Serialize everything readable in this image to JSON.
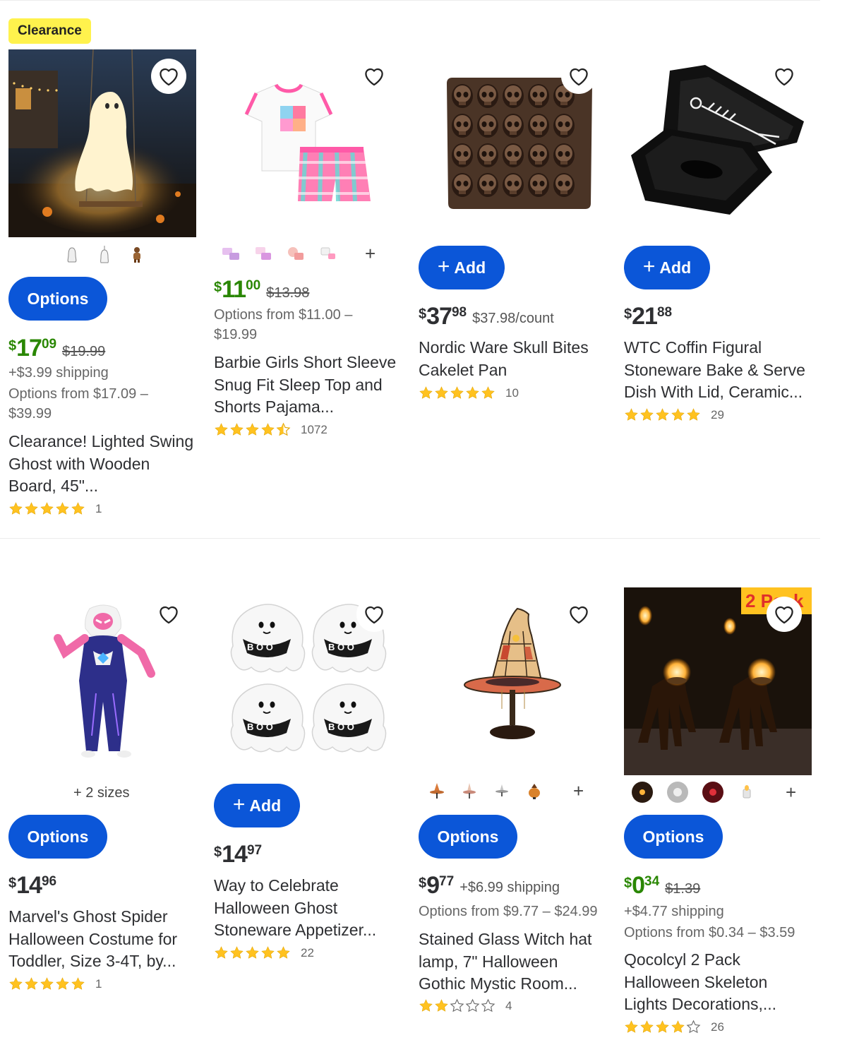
{
  "badge": "Clearance",
  "row1": [
    {
      "button": "Options",
      "price": {
        "currency": "$",
        "dollars": "17",
        "cents": "09",
        "was": "$19.99"
      },
      "shipping": "+$3.99 shipping",
      "options_from": "Options from $17.09 – $39.99",
      "title": "Clearance! Lighted Swing Ghost with Wooden Board, 45\"...",
      "stars": 5,
      "reviews": "1"
    },
    {
      "price": {
        "currency": "$",
        "dollars": "11",
        "cents": "00",
        "was": "$13.98"
      },
      "options_from": "Options from $11.00 – $19.99",
      "title": "Barbie Girls Short Sleeve Snug Fit Sleep Top and Shorts Pajama...",
      "stars": 4.5,
      "reviews": "1072",
      "plus": "+"
    },
    {
      "button": "Add",
      "price": {
        "currency": "$",
        "dollars": "37",
        "cents": "98",
        "unit": "$37.98/count"
      },
      "title": "Nordic Ware Skull Bites Cakelet Pan",
      "stars": 5,
      "reviews": "10"
    },
    {
      "button": "Add",
      "price": {
        "currency": "$",
        "dollars": "21",
        "cents": "88"
      },
      "title": "WTC Coffin Figural Stoneware Bake & Serve Dish With Lid, Ceramic...",
      "stars": 5,
      "reviews": "29"
    }
  ],
  "row2": [
    {
      "sizes": "+ 2 sizes",
      "button": "Options",
      "price": {
        "currency": "$",
        "dollars": "14",
        "cents": "96"
      },
      "title": "Marvel's Ghost Spider Halloween Costume for Toddler, Size 3-4T, by...",
      "stars": 5,
      "reviews": "1"
    },
    {
      "button": "Add",
      "price": {
        "currency": "$",
        "dollars": "14",
        "cents": "97"
      },
      "title": "Way to Celebrate Halloween Ghost Stoneware Appetizer...",
      "stars": 5,
      "reviews": "22"
    },
    {
      "button": "Options",
      "price": {
        "currency": "$",
        "dollars": "9",
        "cents": "77",
        "shipping": "+$6.99 shipping"
      },
      "options_from": "Options from $9.77 – $24.99",
      "title": "Stained Glass Witch hat lamp, 7\" Halloween Gothic Mystic Room...",
      "stars": 2,
      "reviews": "4",
      "plus": "+"
    },
    {
      "pack_badge": "2 Pack",
      "button": "Options",
      "price": {
        "currency": "$",
        "dollars": "0",
        "cents": "34",
        "was": "$1.39"
      },
      "shipping": "+$4.77 shipping",
      "options_from": "Options from $0.34 – $3.59",
      "title": "Qocolcyl 2 Pack Halloween Skeleton Lights Decorations,...",
      "stars": 4,
      "reviews": "26",
      "plus": "+"
    }
  ],
  "colors": {
    "primary_blue": "#0b56d8",
    "price_green": "#2a8703",
    "star_gold": "#ffc220",
    "clearance_yellow": "#fff24d"
  }
}
